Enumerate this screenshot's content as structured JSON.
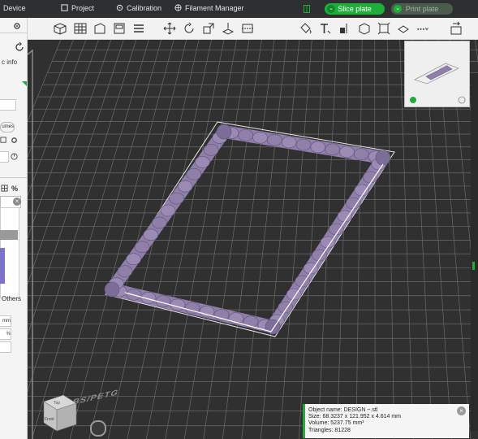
{
  "topbar": {
    "device": "Device",
    "project": "Project",
    "calibration": "Calibration",
    "filament_manager": "Filament Manager",
    "slice_plate": "Slice plate",
    "print_plate": "Print plate"
  },
  "sidebar": {
    "title": "c info",
    "button_fragment": "umes",
    "tab_percent": "%",
    "others": "Others",
    "unit_mm": "mm",
    "unit_percent": "%"
  },
  "bed": {
    "label": "G /ABS/PETG"
  },
  "cube": {
    "top": "Top",
    "front": "Front"
  },
  "info": {
    "object_name": "Object name: DESIGN ~.stl",
    "size": "Size: 68.3237 x 121.952 x 4.614 mm",
    "volume": "Volume: 5237.75 mm³",
    "triangles": "Triangles: 81228"
  },
  "colors": {
    "accent": "#1fae3a",
    "model": "#8f7fa9",
    "viewport_bg": "#303031",
    "grid": "#6a6a6a"
  },
  "icons": {
    "toolbar": [
      "add-object-icon",
      "grid-icon",
      "orient-icon",
      "arrange-icon",
      "layers-icon",
      "move-icon",
      "rotate-icon",
      "scale-icon",
      "place-on-face-icon",
      "cut-icon",
      "paint-icon",
      "text-icon",
      "measure-icon",
      "assembly-icon",
      "fit-icon",
      "more-icon",
      "return-icon"
    ]
  }
}
